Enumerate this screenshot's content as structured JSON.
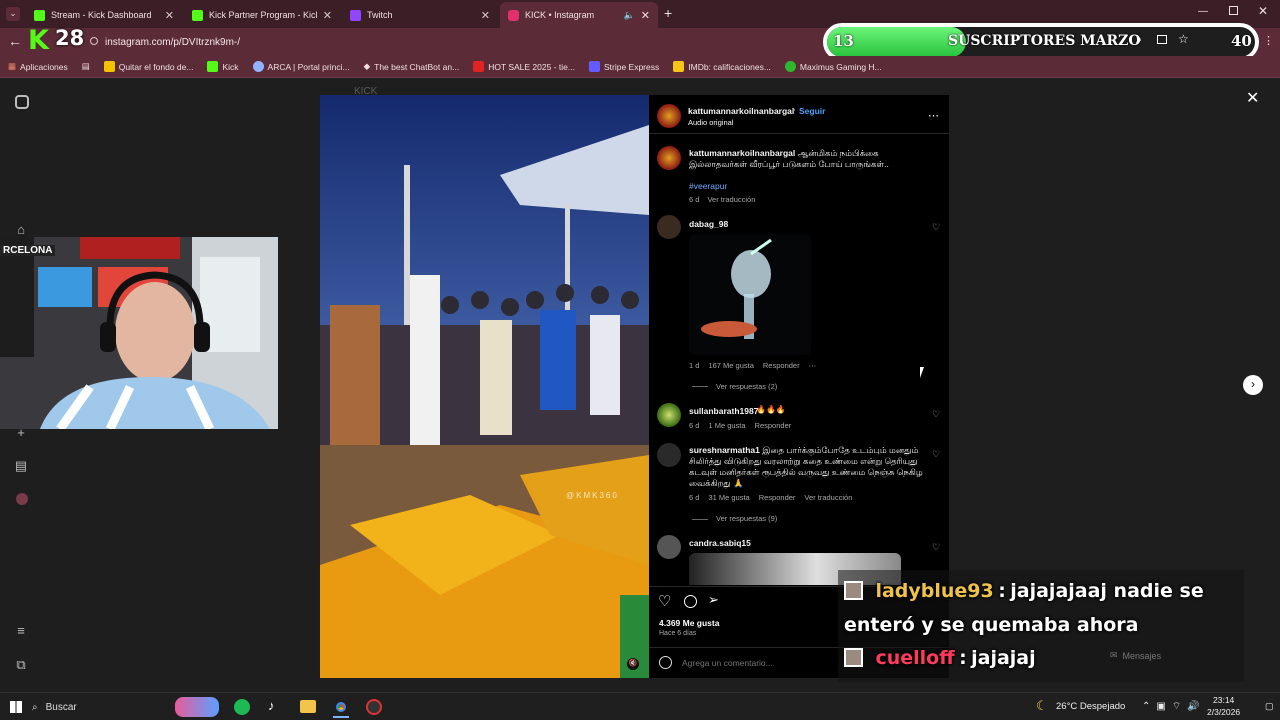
{
  "browser": {
    "tabs": [
      {
        "label": "Stream - Kick Dashboard",
        "color": "#53fc18"
      },
      {
        "label": "Kick Partner Program - Kick Da",
        "color": "#53fc18"
      },
      {
        "label": "Twitch",
        "color": "#9146ff"
      },
      {
        "label": "KICK • Instagram",
        "color": "#e1306c"
      }
    ],
    "url": "instagram.com/p/DVItrznk9m-/",
    "new_tab": "+",
    "bookmarks": [
      "Aplicaciones",
      "Quitar el fondo de...",
      "Kick",
      "ARCA | Portal princi...",
      "The best ChatBot an...",
      "HOT SALE 2025 - tie...",
      "Stripe Express",
      "IMDb: calificaciones...",
      "Maximus Gaming H..."
    ]
  },
  "kick_overlay": {
    "logo": "K",
    "viewer_count": "28",
    "subs_current": "13",
    "subs_label": "SUSCRIPTORES MARZO",
    "subs_goal": "40",
    "subs_progress": 0.325
  },
  "post": {
    "author": "kattumannarkoilnanbargal",
    "follow": "Seguir",
    "audio": "Audio original",
    "caption_author": "kattumannarkoilnanbargal",
    "caption_text": "ஆன்மிகம் நம்பிக்கை இல்லாதவர்கள் வீரப்பூர் படுகளம் போய் பாருங்கள்..",
    "hashtag": "#veerapur",
    "caption_age": "6 d",
    "see_translation": "Ver traducción",
    "watermark": "@KMK360",
    "likes": "4.369 Me gusta",
    "posted": "Hace 6 días",
    "add_comment_placeholder": "Agrega un comentario...",
    "header_text": "KICK",
    "comments": [
      {
        "user": "dabag_98",
        "text": "",
        "age": "1 d",
        "likes": "167 Me gusta",
        "reply": "Responder",
        "replies": "Ver respuestas (2)"
      },
      {
        "user": "sullanbarath1987",
        "text": "🔥🔥🔥",
        "age": "6 d",
        "likes": "1 Me gusta",
        "reply": "Responder"
      },
      {
        "user": "sureshnarmatha1",
        "text": "இதை பார்க்கும்போதே உடம்பும் மனதும் சிலிர்த்து விடுகிறது வரலாற்று கதை உண்மை என்று தெரியுது கடவுள் மனிதர்கள் ரூபத்தில் வருவது உண்மை நெஞ்சு நெகிழ வைக்கிறது 🙏",
        "age": "6 d",
        "likes": "31 Me gusta",
        "reply": "Responder",
        "translate": "Ver traducción",
        "replies": "Ver respuestas (9)"
      },
      {
        "user": "candra.sabiq15",
        "text": ""
      }
    ]
  },
  "chat": [
    {
      "user": "ladyblue93",
      "sep": ":",
      "message": "jajajajaaj nadie se enteró y se quemaba ahora",
      "color": "#f0c24a"
    },
    {
      "user": "cuelloff",
      "sep": ":",
      "message": "jajajaj",
      "color": "#ff3b5c"
    }
  ],
  "messages_label": "Mensajes",
  "webcam_banner": "RCELONA",
  "taskbar": {
    "search": "Buscar",
    "weather": "26°C Despejado",
    "time": "23:14",
    "date": "2/3/2026"
  }
}
